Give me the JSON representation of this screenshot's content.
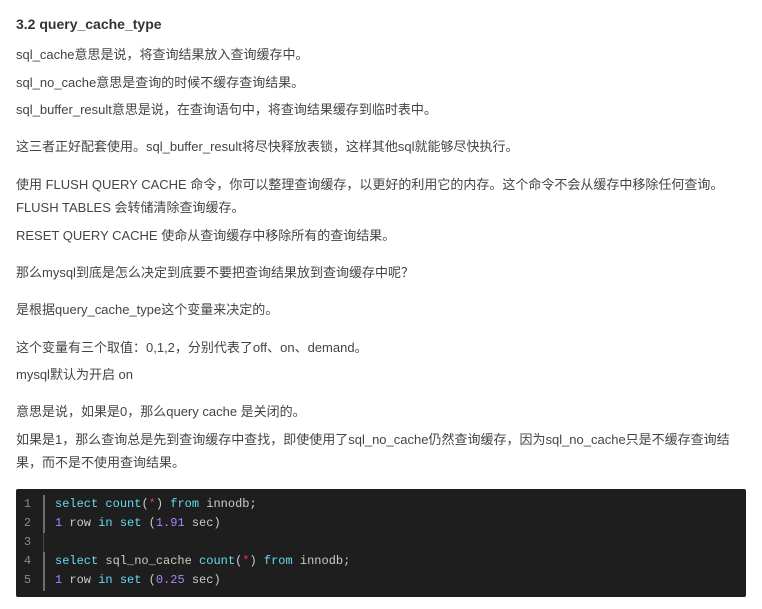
{
  "heading": "3.2 query_cache_type",
  "paras": [
    [
      "sql_cache意思是说，将查询结果放入查询缓存中。",
      "sql_no_cache意思是查询的时候不缓存查询结果。",
      "sql_buffer_result意思是说，在查询语句中，将查询结果缓存到临时表中。"
    ],
    [
      "这三者正好配套使用。sql_buffer_result将尽快释放表锁，这样其他sql就能够尽快执行。"
    ],
    [
      "使用 FLUSH QUERY CACHE 命令，你可以整理查询缓存，以更好的利用它的内存。这个命令不会从缓存中移除任何查询。FLUSH TABLES 会转储清除查询缓存。",
      "RESET QUERY CACHE 使命从查询缓存中移除所有的查询结果。"
    ],
    [
      "那么mysql到底是怎么决定到底要不要把查询结果放到查询缓存中呢？"
    ],
    [
      "是根据query_cache_type这个变量来决定的。"
    ],
    [
      "这个变量有三个取值：0,1,2，分别代表了off、on、demand。",
      "mysql默认为开启 on"
    ],
    [
      "意思是说，如果是0，那么query cache 是关闭的。",
      "如果是1，那么查询总是先到查询缓存中查找，即使使用了sql_no_cache仍然查询缓存，因为sql_no_cache只是不缓存查询结果，而不是不使用查询结果。"
    ]
  ],
  "code": {
    "lines": [
      {
        "n": "1",
        "tokens": [
          [
            "kw",
            "select"
          ],
          [
            "",
            ""
          ],
          [
            "fn",
            "count"
          ],
          [
            "punc",
            "("
          ],
          [
            "op",
            "*"
          ],
          [
            "punc",
            ")"
          ],
          [
            "",
            ""
          ],
          [
            "kw",
            "from"
          ],
          [
            "",
            ""
          ],
          [
            "id",
            "innodb"
          ],
          [
            "punc",
            ";"
          ]
        ]
      },
      {
        "n": "2",
        "tokens": [
          [
            "num",
            "1"
          ],
          [
            "",
            ""
          ],
          [
            "id",
            "row"
          ],
          [
            "",
            ""
          ],
          [
            "kw",
            "in"
          ],
          [
            "",
            ""
          ],
          [
            "kw",
            "set"
          ],
          [
            "",
            ""
          ],
          [
            "punc",
            "("
          ],
          [
            "num",
            "1.91"
          ],
          [
            "",
            ""
          ],
          [
            "id",
            "sec"
          ],
          [
            "punc",
            ")"
          ]
        ]
      },
      {
        "n": "3",
        "tokens": []
      },
      {
        "n": "4",
        "tokens": [
          [
            "kw",
            "select"
          ],
          [
            "",
            ""
          ],
          [
            "id",
            "sql_no_cache"
          ],
          [
            "",
            ""
          ],
          [
            "fn",
            "count"
          ],
          [
            "punc",
            "("
          ],
          [
            "op",
            "*"
          ],
          [
            "punc",
            ")"
          ],
          [
            "",
            ""
          ],
          [
            "kw",
            "from"
          ],
          [
            "",
            ""
          ],
          [
            "id",
            "innodb"
          ],
          [
            "punc",
            ";"
          ]
        ]
      },
      {
        "n": "5",
        "tokens": [
          [
            "num",
            "1"
          ],
          [
            "",
            ""
          ],
          [
            "id",
            "row"
          ],
          [
            "",
            ""
          ],
          [
            "kw",
            "in"
          ],
          [
            "",
            ""
          ],
          [
            "kw",
            "set"
          ],
          [
            "",
            ""
          ],
          [
            "punc",
            "("
          ],
          [
            "num",
            "0.25"
          ],
          [
            "",
            ""
          ],
          [
            "id",
            "sec"
          ],
          [
            "punc",
            ")"
          ]
        ]
      }
    ]
  }
}
